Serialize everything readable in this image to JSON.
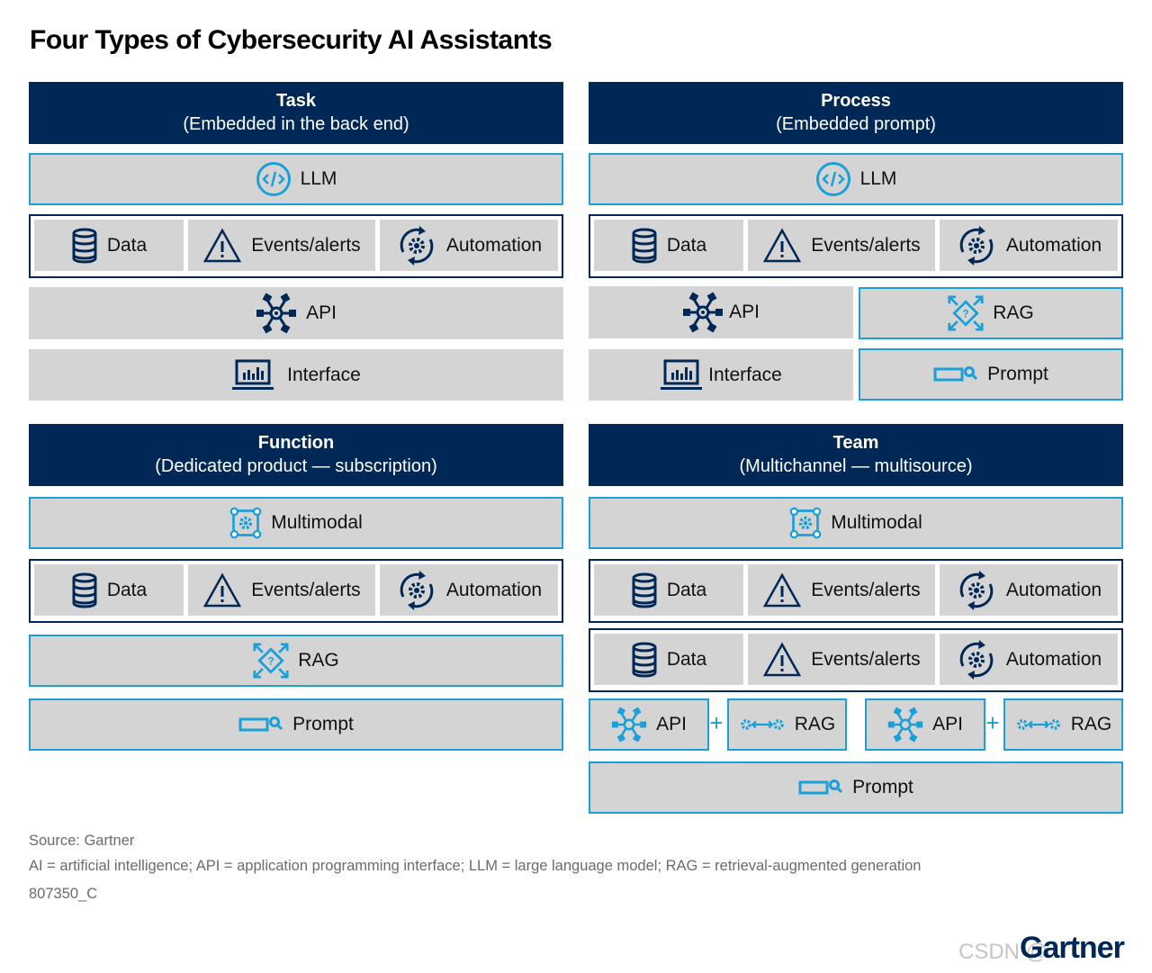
{
  "title": "Four Types of Cybersecurity AI Assistants",
  "colors": {
    "navy": "#002856",
    "accent_blue": "#1aa0d8",
    "box_gray": "#d4d4d4"
  },
  "quadrants": {
    "task": {
      "title": "Task",
      "subtitle": "(Embedded in the back end)",
      "model": {
        "label": "LLM",
        "icon": "code-circle-icon"
      },
      "sources": [
        {
          "label": "Data",
          "icon": "database-icon"
        },
        {
          "label": "Events/alerts",
          "icon": "warning-triangle-icon"
        },
        {
          "label": "Automation",
          "icon": "gear-cycle-icon"
        }
      ],
      "api": {
        "label": "API",
        "icon": "api-network-icon"
      },
      "interface": {
        "label": "Interface",
        "icon": "monitor-chart-icon"
      }
    },
    "process": {
      "title": "Process",
      "subtitle": "(Embedded prompt)",
      "model": {
        "label": "LLM",
        "icon": "code-circle-icon"
      },
      "sources": [
        {
          "label": "Data",
          "icon": "database-icon"
        },
        {
          "label": "Events/alerts",
          "icon": "warning-triangle-icon"
        },
        {
          "label": "Automation",
          "icon": "gear-cycle-icon"
        }
      ],
      "api": {
        "label": "API",
        "icon": "api-network-icon"
      },
      "rag": {
        "label": "RAG",
        "icon": "rag-diamond-icon"
      },
      "interface": {
        "label": "Interface",
        "icon": "monitor-chart-icon"
      },
      "prompt": {
        "label": "Prompt",
        "icon": "prompt-search-icon"
      }
    },
    "function": {
      "title": "Function",
      "subtitle": "(Dedicated product — subscription)",
      "model": {
        "label": "Multimodal",
        "icon": "multimodal-gear-icon"
      },
      "sources": [
        {
          "label": "Data",
          "icon": "database-icon"
        },
        {
          "label": "Events/alerts",
          "icon": "warning-triangle-icon"
        },
        {
          "label": "Automation",
          "icon": "gear-cycle-icon"
        }
      ],
      "rag": {
        "label": "RAG",
        "icon": "rag-diamond-icon"
      },
      "prompt": {
        "label": "Prompt",
        "icon": "prompt-search-icon"
      }
    },
    "team": {
      "title": "Team",
      "subtitle": "(Multichannel — multisource)",
      "model": {
        "label": "Multimodal",
        "icon": "multimodal-gear-icon"
      },
      "sources_1": [
        {
          "label": "Data",
          "icon": "database-icon"
        },
        {
          "label": "Events/alerts",
          "icon": "warning-triangle-icon"
        },
        {
          "label": "Automation",
          "icon": "gear-cycle-icon"
        }
      ],
      "sources_2": [
        {
          "label": "Data",
          "icon": "database-icon"
        },
        {
          "label": "Events/alerts",
          "icon": "warning-triangle-icon"
        },
        {
          "label": "Automation",
          "icon": "gear-cycle-icon"
        }
      ],
      "channels": [
        {
          "api": "API",
          "plus": "+",
          "rag": "RAG"
        },
        {
          "api": "API",
          "plus": "+",
          "rag": "RAG"
        }
      ],
      "prompt": {
        "label": "Prompt",
        "icon": "prompt-search-icon"
      }
    }
  },
  "footer": {
    "source": "Source: Gartner",
    "abbreviations": "AI = artificial intelligence; API = application programming interface; LLM = large language model; RAG = retrieval-augmented generation",
    "id": "807350_C"
  },
  "logo": "Gartner",
  "watermark": "CSDN @"
}
